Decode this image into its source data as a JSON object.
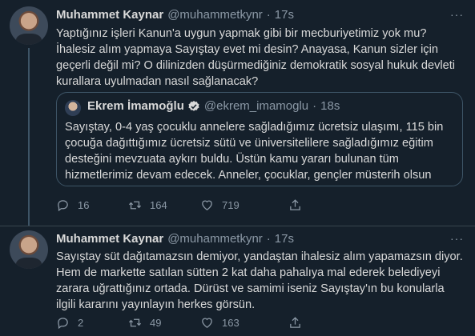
{
  "tweets": [
    {
      "name": "Muhammet Kaynar",
      "handle": "@muhammetkynr",
      "dot": "·",
      "time": "17s",
      "more": "···",
      "text": "Yaptığınız işleri Kanun'a uygun yapmak gibi bir mecburiyetimiz yok mu? İhalesiz alım yapmaya Sayıştay evet mi desin? Anayasa, Kanun sizler için geçerli değil mi? O dilinizden düşürmediğiniz demokratik sosyal hukuk devleti kurallara uyulmadan nasıl sağlanacak?",
      "quote": {
        "name": "Ekrem İmamoğlu",
        "handle": "@ekrem_imamoglu",
        "dot": "·",
        "time": "18s",
        "text": "Sayıştay, 0-4 yaş çocuklu annelere sağladığımız ücretsiz ulaşımı, 115 bin çocuğa dağıttığımız ücretsiz sütü ve üniversitelilere sağladığımız eğitim desteğini mevzuata aykırı buldu. Üstün kamu yararı bulunan tüm hizmetlerimiz devam edecek. Anneler, çocuklar, gençler müsterih olsun"
      },
      "actions": {
        "replies": "16",
        "retweets": "164",
        "likes": "719"
      }
    },
    {
      "name": "Muhammet Kaynar",
      "handle": "@muhammetkynr",
      "dot": "·",
      "time": "17s",
      "more": "···",
      "text": "Sayıştay süt dağıtamazsın demiyor, yandaştan ihalesiz alım yapamazsın diyor. Hem de markette satılan sütten 2 kat daha pahalıya mal ederek belediyeyi zarara uğrattığınız ortada. Dürüst ve samimi iseniz Sayıştay'ın bu konularla ilgili kararını yayınlayın herkes görsün.",
      "actions": {
        "replies": "2",
        "retweets": "49",
        "likes": "163"
      }
    }
  ],
  "colors": {
    "background": "#15202b",
    "text": "#d9d9d9",
    "muted": "#8b98a5",
    "border": "#38444d",
    "verified": "#d9d9d9"
  }
}
